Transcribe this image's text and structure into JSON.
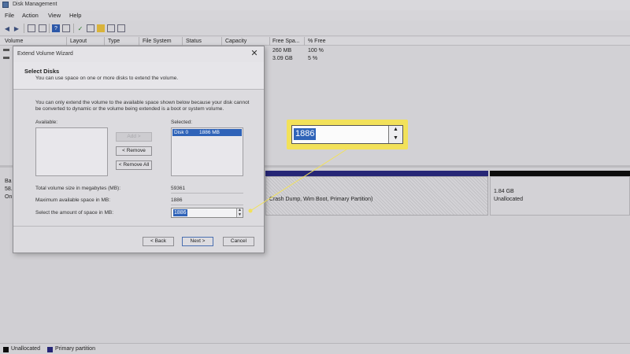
{
  "window": {
    "title": "Disk Management"
  },
  "menu": [
    "File",
    "Action",
    "View",
    "Help"
  ],
  "columns": [
    "Volume",
    "Layout",
    "Type",
    "File System",
    "Status",
    "Capacity",
    "Free Spa...",
    "% Free"
  ],
  "volume_rows": [
    {
      "free": "260 MB",
      "pct": "100 %"
    },
    {
      "free": "3.09 GB",
      "pct": "5 %"
    }
  ],
  "disk": {
    "label_fragments": [
      "Ba",
      "58.",
      "On"
    ],
    "partition_text": ", Crash Dump, Wim Boot, Primary Partition)",
    "unalloc_size": "1.84 GB",
    "unalloc_label": "Unallocated"
  },
  "legend": [
    {
      "label": "Unallocated",
      "color": "#0c0c0c"
    },
    {
      "label": "Primary partition",
      "color": "#262676"
    }
  ],
  "dialog": {
    "title": "Extend Volume Wizard",
    "heading": "Select Disks",
    "subheading": "You can use space on one or more disks to extend the volume.",
    "description": "You can only extend the volume to the available space shown below because your disk cannot be converted to dynamic or the volume being extended is a boot or system volume.",
    "available_label": "Available:",
    "selected_label": "Selected:",
    "selected_item_disk": "Disk 0",
    "selected_item_size": "1886 MB",
    "add_button": "Add >",
    "remove_button": "< Remove",
    "remove_all_button": "< Remove All",
    "total_label": "Total volume size in megabytes (MB):",
    "total_value": "59361",
    "max_label": "Maximum available space in MB:",
    "max_value": "1886",
    "select_label": "Select the amount of space in MB:",
    "select_value": "1886",
    "back_button": "< Back",
    "next_button": "Next >",
    "cancel_button": "Cancel"
  },
  "callout": {
    "value": "1886",
    "color": "#f2e15a"
  }
}
